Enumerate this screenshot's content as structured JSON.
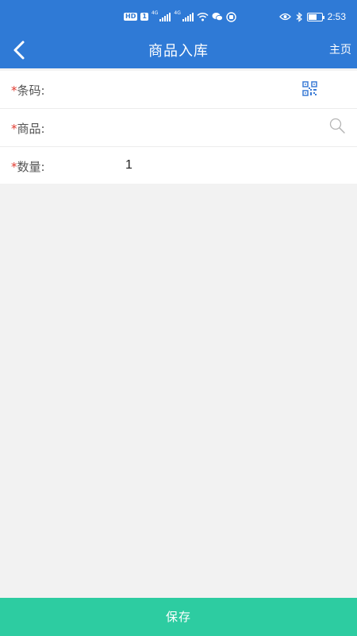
{
  "status_bar": {
    "time": "2:53",
    "hd_badge": "HD",
    "sim_badge": "1",
    "network_1": "4G",
    "network_2": "4G",
    "icons": [
      "hd-icon",
      "signal-icon",
      "signal-icon",
      "wifi-icon",
      "wechat-icon",
      "notification-icon",
      "eye-icon",
      "bluetooth-icon",
      "battery-icon"
    ]
  },
  "nav": {
    "title": "商品入库",
    "home_label": "主页",
    "back_icon": "chevron-left-icon"
  },
  "form": {
    "required_mark": "*",
    "barcode": {
      "label": "条码:",
      "value": "",
      "icon": "qr-code-icon"
    },
    "product": {
      "label": "商品:",
      "value": "",
      "icon": "search-icon"
    },
    "quantity": {
      "label": "数量:",
      "value": "1"
    }
  },
  "footer": {
    "save_label": "保存"
  },
  "colors": {
    "primary": "#2f7ad6",
    "accent": "#2dcca1",
    "required": "#e03a2f",
    "background": "#f2f2f2"
  }
}
